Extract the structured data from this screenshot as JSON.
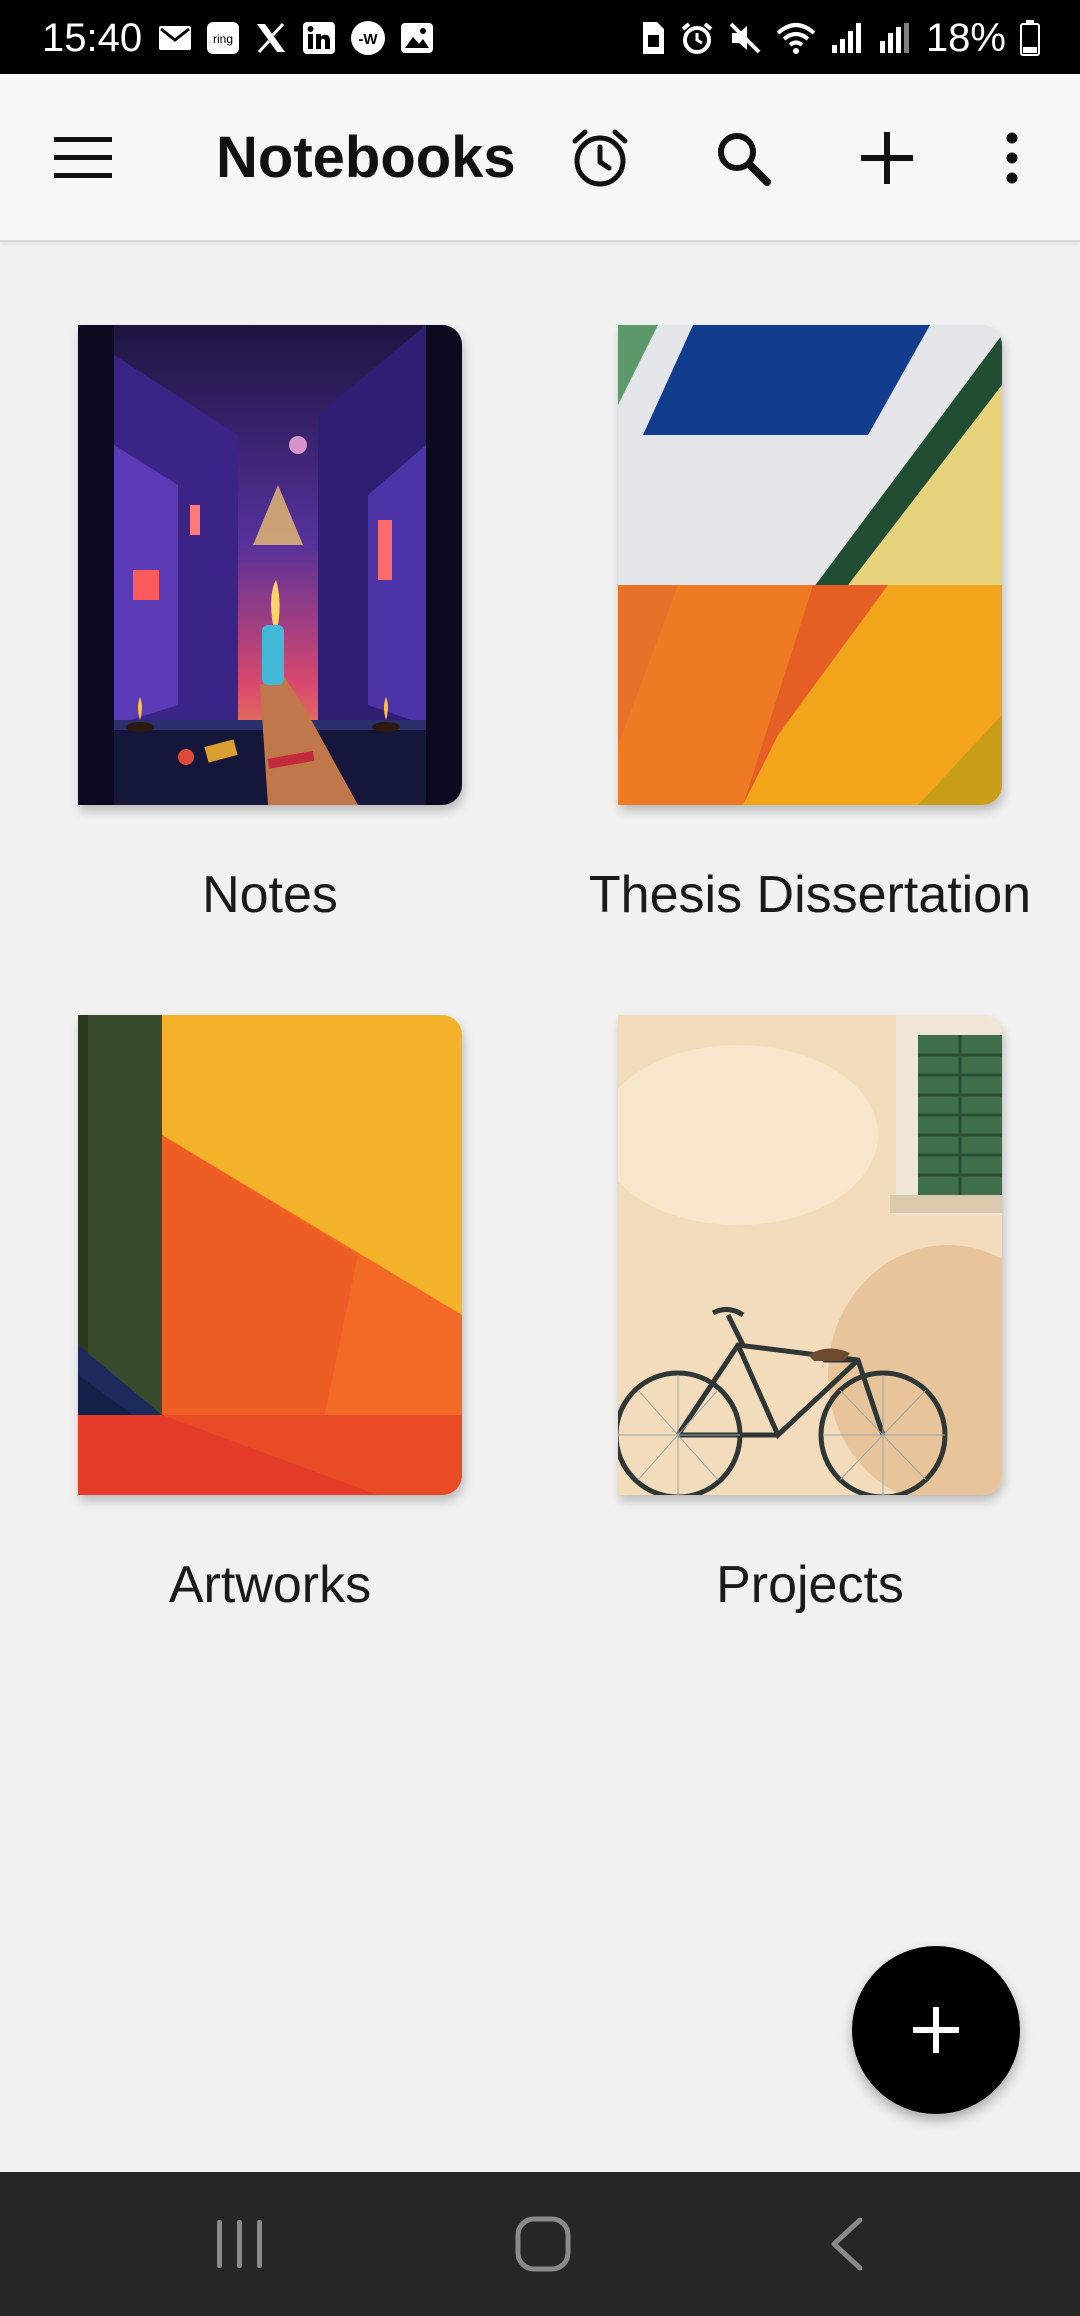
{
  "status_bar": {
    "time": "15:40",
    "battery_percent": "18%",
    "notification_icons": [
      "gmail-icon",
      "ring-icon",
      "x-icon",
      "linkedin-icon",
      "wn-icon",
      "gallery-icon"
    ],
    "ring_label": "ring",
    "wn_label": "-W",
    "system_icons": [
      "sim-icon",
      "alarm-icon",
      "mute-icon",
      "wifi-icon",
      "signal-icon",
      "signal-2-icon",
      "battery-icon"
    ]
  },
  "app_bar": {
    "title": "Notebooks",
    "actions": [
      "menu-icon",
      "alarm-icon",
      "search-icon",
      "add-icon",
      "more-vert-icon"
    ]
  },
  "notebooks": [
    {
      "title": "Notes",
      "cover": "night-street-festival"
    },
    {
      "title": "Thesis Dissertation",
      "cover": "geometric-blue-green-orange-canvas"
    },
    {
      "title": "Artworks",
      "cover": "orange-yellow-green-canvas"
    },
    {
      "title": "Projects",
      "cover": "bicycle-and-window"
    }
  ],
  "fab": {
    "icon": "add-icon"
  },
  "nav_bar": {
    "buttons": [
      "recents-icon",
      "home-icon",
      "back-icon"
    ]
  }
}
